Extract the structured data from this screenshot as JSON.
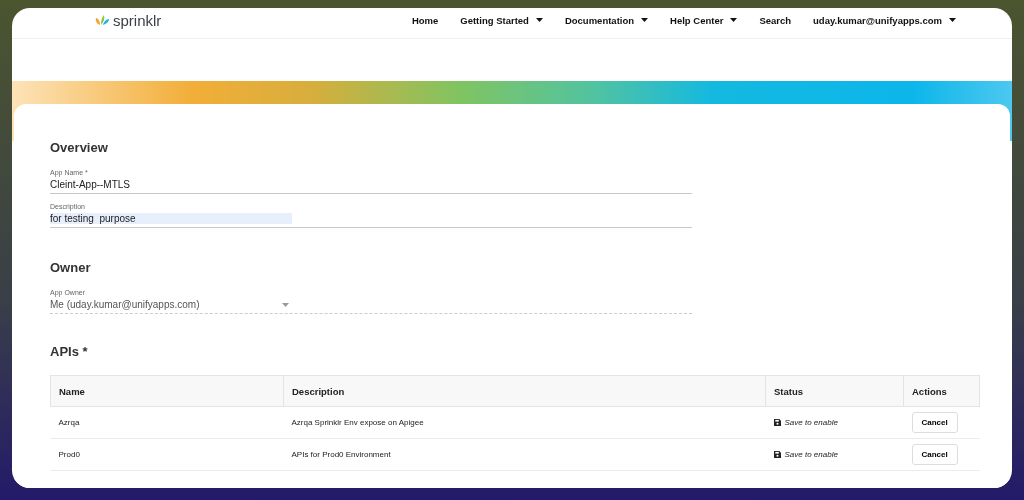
{
  "header": {
    "logo": "sprinklr",
    "nav": [
      {
        "label": "Home",
        "dropdown": false
      },
      {
        "label": "Getting Started",
        "dropdown": true
      },
      {
        "label": "Documentation",
        "dropdown": true
      },
      {
        "label": "Help Center",
        "dropdown": true
      },
      {
        "label": "Search",
        "dropdown": false
      },
      {
        "label": "uday.kumar@unifyapps.com",
        "dropdown": true
      }
    ]
  },
  "overview": {
    "title": "Overview",
    "app_name": {
      "label": "App Name *",
      "value": "Cleint-App--MTLS"
    },
    "description": {
      "label": "Description",
      "value": "for testing  purpose"
    }
  },
  "owner": {
    "title": "Owner",
    "app_owner": {
      "label": "App Owner",
      "value": "Me (uday.kumar@unifyapps.com)"
    }
  },
  "apis": {
    "title": "APIs *",
    "columns": [
      "Name",
      "Description",
      "Status",
      "Actions"
    ],
    "rows": [
      {
        "name": "Azrqa",
        "description": "Azrqa Sprinklr Env expose on Apigee",
        "status": "Save to enable",
        "action": "Cancel"
      },
      {
        "name": "Prod0",
        "description": "APIs for Prod0 Environment",
        "status": "Save to enable",
        "action": "Cancel"
      }
    ]
  }
}
